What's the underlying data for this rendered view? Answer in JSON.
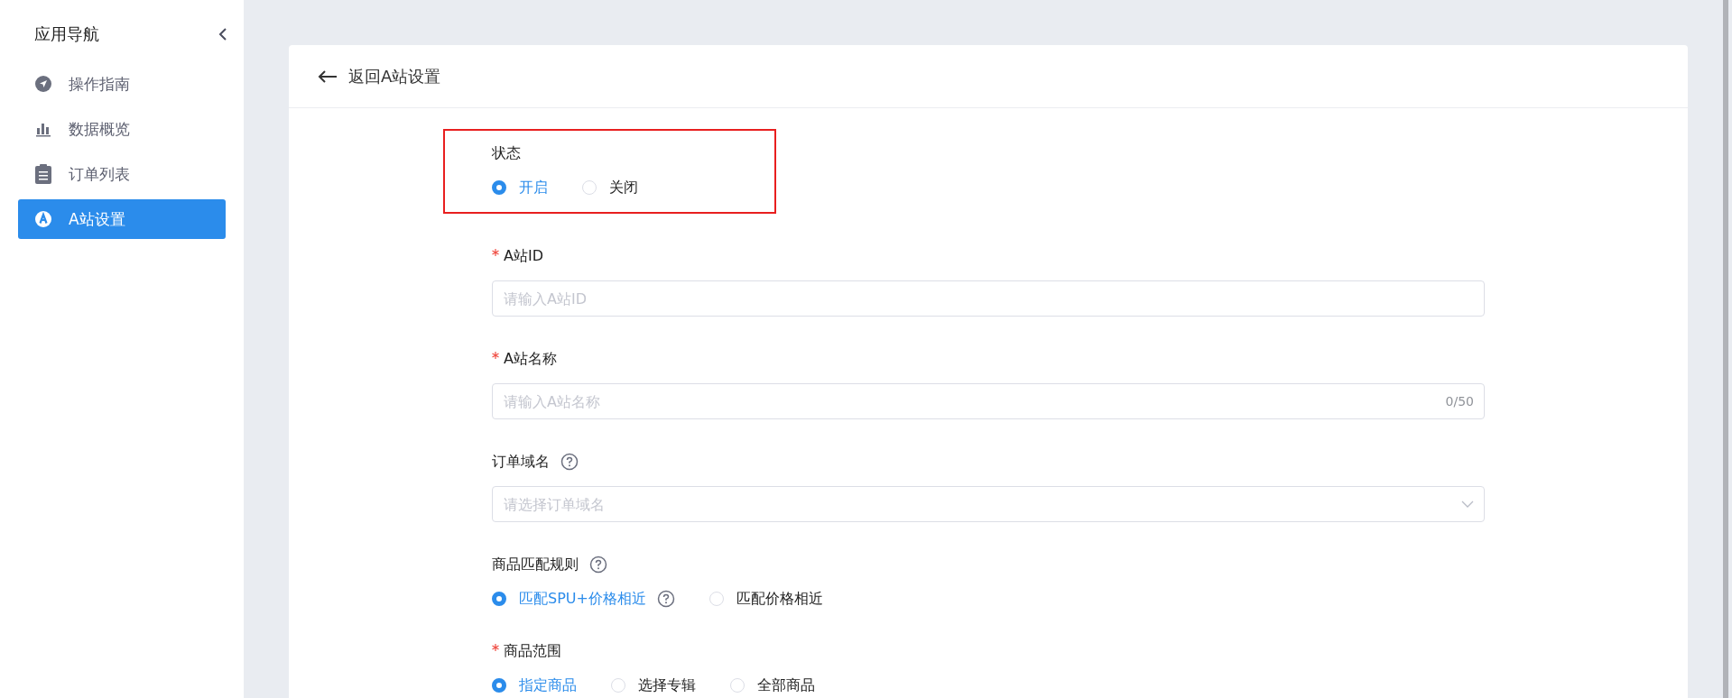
{
  "sidebar": {
    "title": "应用导航",
    "items": [
      {
        "label": "操作指南",
        "kind": "compass",
        "selected": false
      },
      {
        "label": "数据概览",
        "kind": "chart",
        "selected": false
      },
      {
        "label": "订单列表",
        "kind": "clipboard",
        "selected": false
      },
      {
        "label": "A站设置",
        "kind": "letter",
        "selected": true
      }
    ]
  },
  "page": {
    "back_label": "返回A站设置",
    "fields": [
      {
        "kind": "radio",
        "label": "状态",
        "required": false,
        "help": false,
        "highlighted": true,
        "options": [
          {
            "label": "开启",
            "selected": true,
            "help": false
          },
          {
            "label": "关闭",
            "selected": false,
            "help": false
          }
        ]
      },
      {
        "kind": "input",
        "label": "A站ID",
        "required": true,
        "help": false,
        "highlighted": false,
        "placeholder": "请输入A站ID"
      },
      {
        "kind": "input",
        "label": "A站名称",
        "required": true,
        "help": false,
        "highlighted": false,
        "placeholder": "请输入A站名称",
        "counter": "0/50"
      },
      {
        "kind": "select",
        "label": "订单域名",
        "required": false,
        "help": true,
        "highlighted": false,
        "placeholder": "请选择订单域名"
      },
      {
        "kind": "radio",
        "label": "商品匹配规则",
        "required": false,
        "help": true,
        "highlighted": false,
        "options": [
          {
            "label": "匹配SPU+价格相近",
            "selected": true,
            "help": true
          },
          {
            "label": "匹配价格相近",
            "selected": false,
            "help": false
          }
        ]
      },
      {
        "kind": "radio",
        "label": "商品范围",
        "required": true,
        "help": false,
        "highlighted": false,
        "options": [
          {
            "label": "指定商品",
            "selected": true,
            "help": false
          },
          {
            "label": "选择专辑",
            "selected": false,
            "help": false
          },
          {
            "label": "全部商品",
            "selected": false,
            "help": false
          }
        ]
      }
    ]
  }
}
